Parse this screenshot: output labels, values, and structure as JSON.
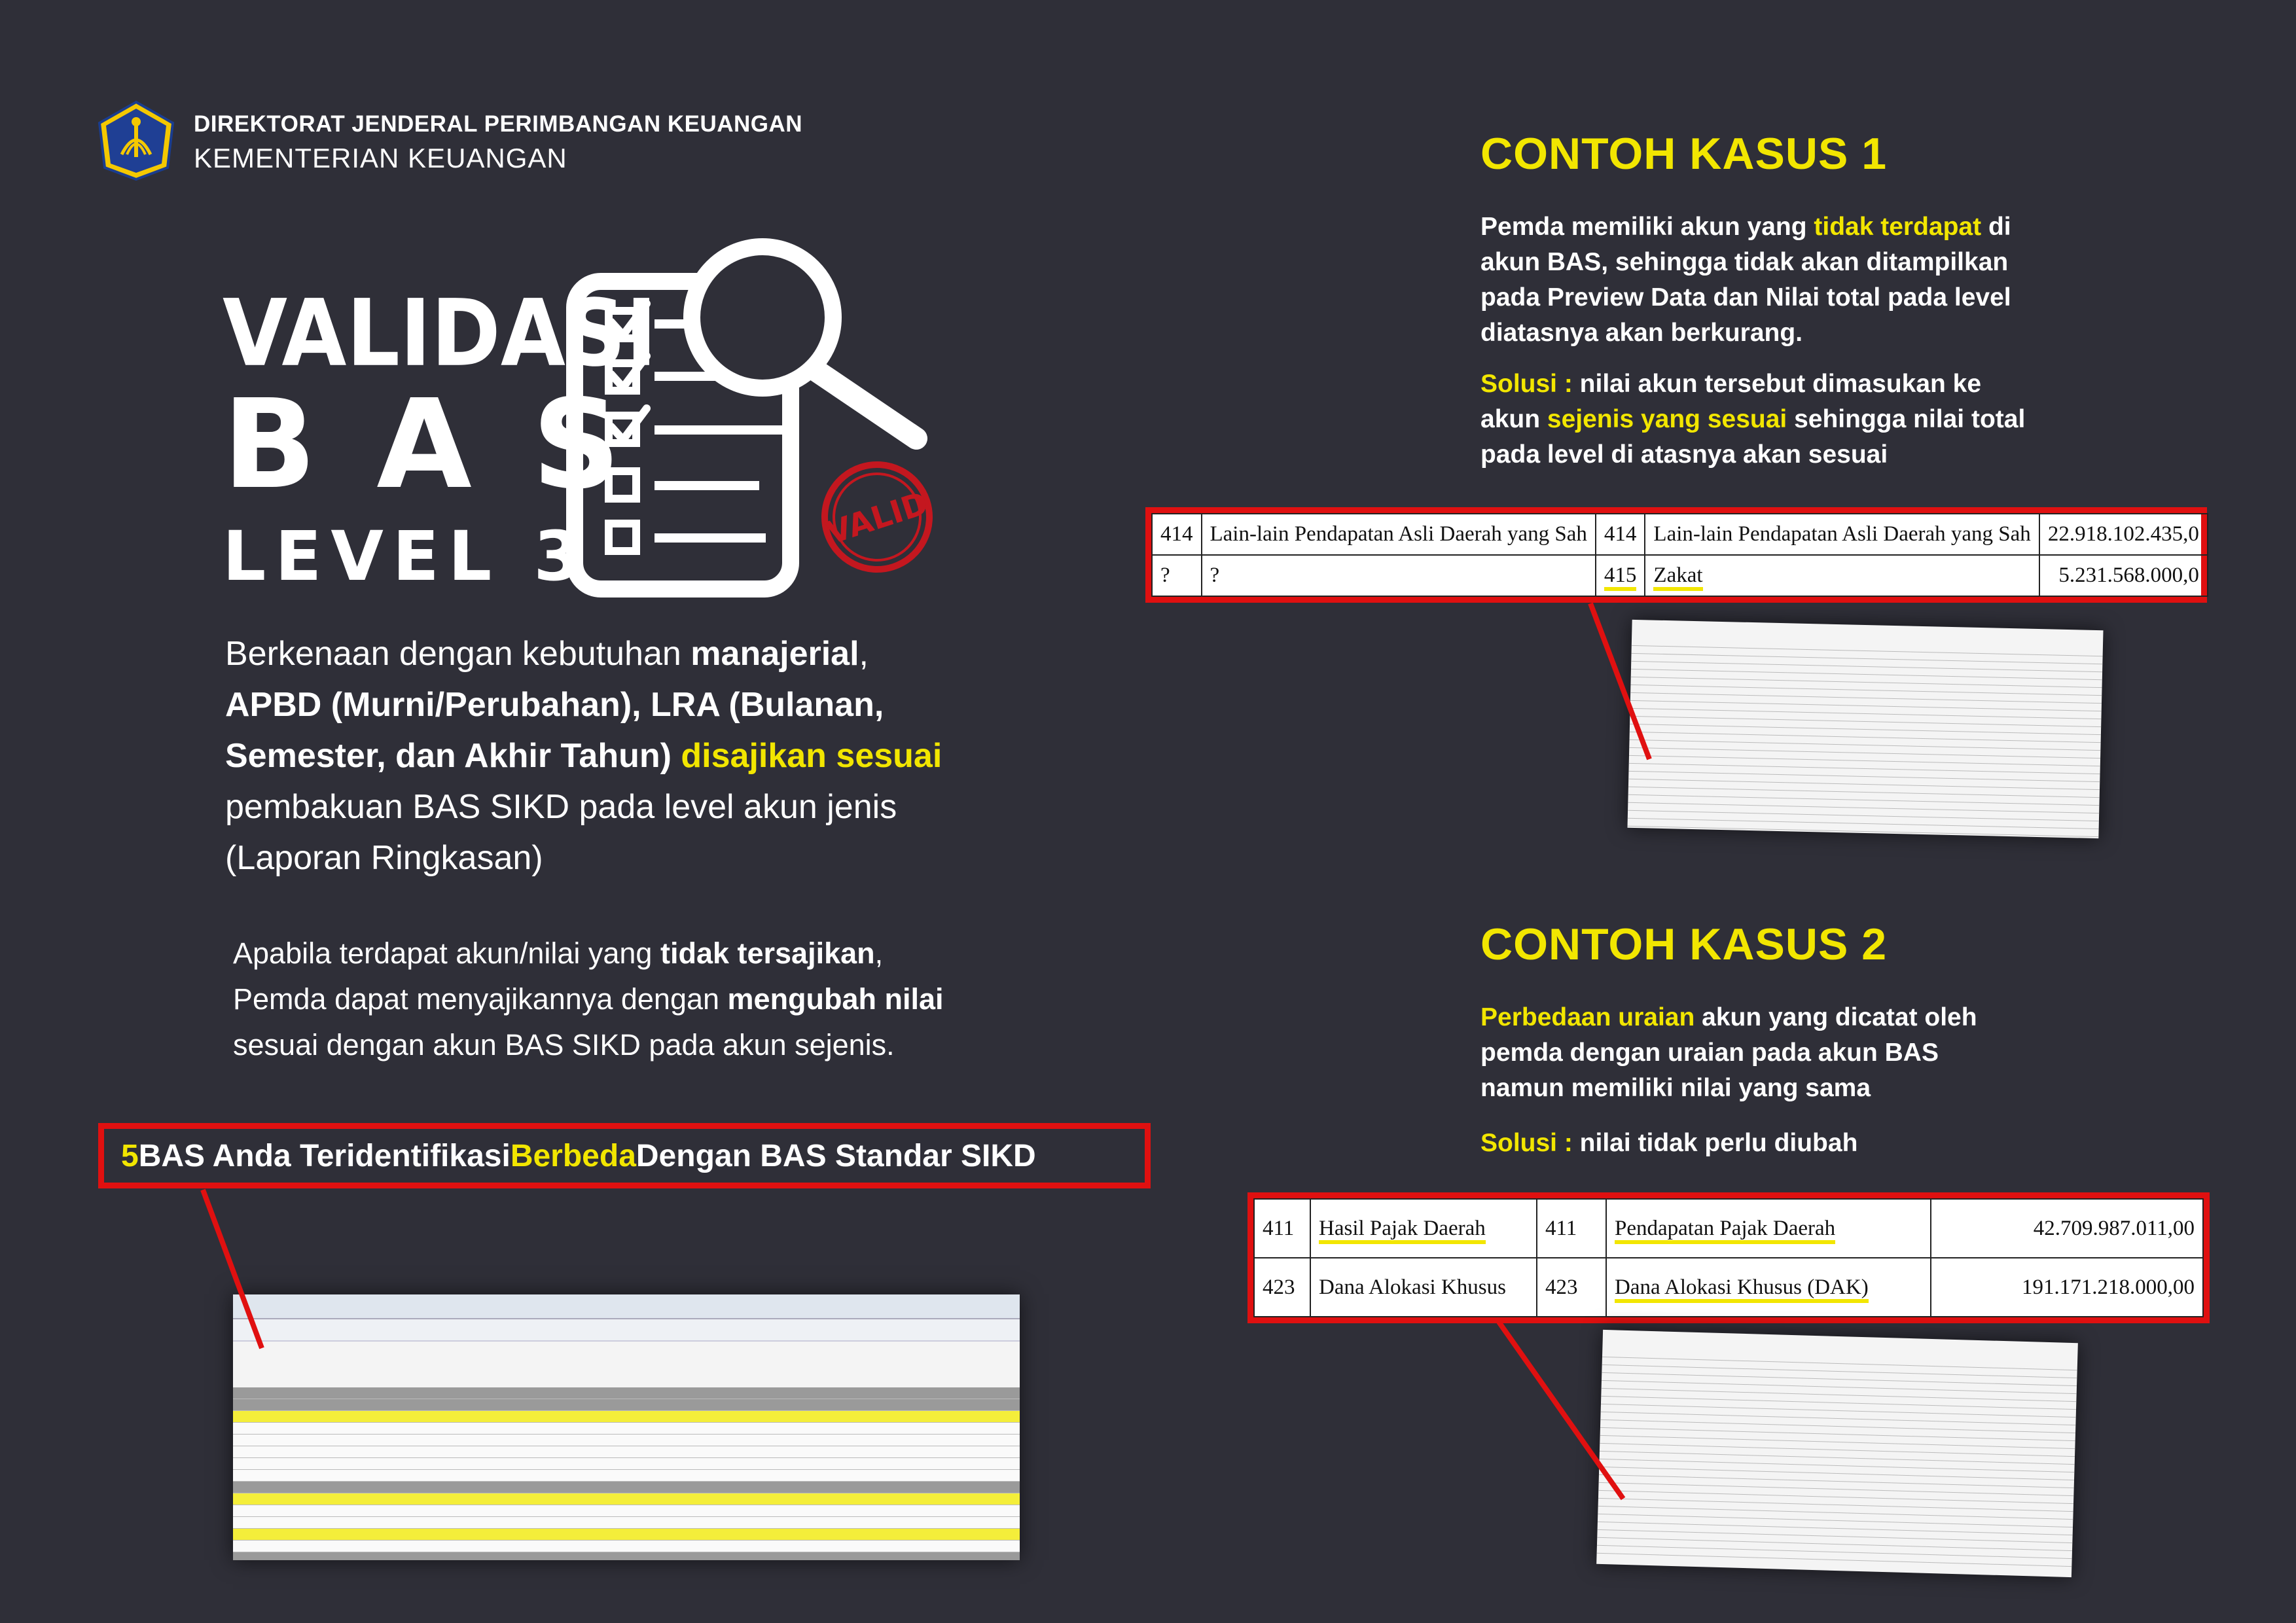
{
  "header": {
    "org_line1": "DIREKTORAT JENDERAL PERIMBANGAN KEUANGAN",
    "org_line2": "KEMENTERIAN KEUANGAN",
    "logo_icon": "kemenkeu-logo-icon"
  },
  "hero": {
    "title_1": "VALIDASI",
    "title_2": "BAS",
    "title_3": "LEVEL 3",
    "icon": "checklist-magnifier-icon",
    "stamp": "VALID"
  },
  "intro": {
    "p1_a": "Berkenaan dengan kebutuhan ",
    "p1_b": "manajerial",
    "p1_c": ",",
    "p1_d": "APBD (Murni/Perubahan), LRA (Bulanan,",
    "p1_e": "Semester, dan Akhir Tahun)",
    "p1_f": " disajikan sesuai",
    "p1_g": "pembakuan BAS SIKD pada level akun jenis",
    "p1_h": "(Laporan Ringkasan)",
    "p2_a": "Apabila terdapat akun/nilai yang ",
    "p2_b": "tidak tersajikan",
    "p2_c": ",",
    "p2_d": "Pemda dapat menyajikannya dengan ",
    "p2_e": "mengubah nilai",
    "p2_f": "sesuai dengan akun BAS SIKD pada akun sejenis."
  },
  "banner": {
    "count": "5",
    "text_a": " BAS Anda Teridentifikasi ",
    "text_b": "Berbeda",
    "text_c": " Dengan BAS Standar SIKD"
  },
  "case1": {
    "heading": "CONTOH KASUS 1",
    "desc_a": "Pemda memiliki akun yang ",
    "desc_b": "tidak terdapat",
    "desc_c": " di",
    "desc_d": "akun BAS, sehingga tidak akan ditampilkan",
    "desc_e": "pada Preview Data dan Nilai total pada level",
    "desc_f": "diatasnya akan berkurang.",
    "sol_label": "Solusi :",
    "sol_a": " nilai akun tersebut dimasukan ke",
    "sol_b": "akun ",
    "sol_c": "sejenis yang sesuai",
    "sol_d": " sehingga nilai total",
    "sol_e": "pada level di atasnya akan sesuai",
    "table": [
      [
        "414",
        "Lain-lain Pendapatan Asli Daerah yang Sah",
        "414",
        "Lain-lain Pendapatan Asli Daerah yang Sah",
        "22.918.102.435,0"
      ],
      [
        "?",
        "?",
        "415",
        "Zakat",
        "5.231.568.000,0"
      ]
    ]
  },
  "case2": {
    "heading": "CONTOH KASUS 2",
    "desc_a": "Perbedaan uraian",
    "desc_b": " akun yang dicatat oleh",
    "desc_c": "pemda dengan uraian pada akun BAS",
    "desc_d": "namun memiliki nilai yang sama",
    "sol_label": "Solusi :",
    "sol_a": " nilai tidak perlu diubah",
    "table": [
      [
        "411",
        "Hasil Pajak Daerah",
        "411",
        "Pendapatan Pajak Daerah",
        "42.709.987.011,00"
      ],
      [
        "423",
        "Dana Alokasi Khusus",
        "423",
        "Dana Alokasi Khusus (DAK)",
        "191.171.218.000,00"
      ]
    ]
  },
  "colors": {
    "background": "#2f2f38",
    "accent_yellow": "#f2e600",
    "highlight_red": "#e01010"
  }
}
